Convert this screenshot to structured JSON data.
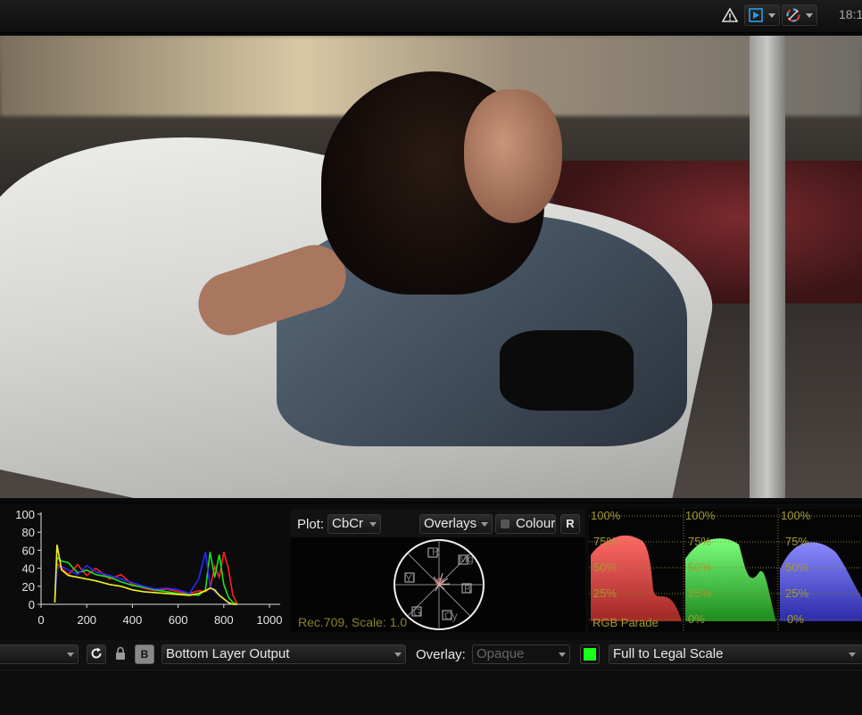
{
  "topbar": {
    "warning_icon": "warning-triangle-icon",
    "view_icon": "play-monitor-icon",
    "colour_icon": "colour-wheel-icon",
    "time": "18:1"
  },
  "histogram": {
    "y_ticks": [
      "100",
      "80",
      "60",
      "40",
      "20",
      "0"
    ],
    "x_ticks": [
      "0",
      "200",
      "400",
      "600",
      "800",
      "1000"
    ]
  },
  "vectorscope": {
    "plot_label": "Plot:",
    "plot_value": "CbCr",
    "overlays_label": "Overlays",
    "colour_label": "Colour",
    "r_button": "R",
    "targets": [
      "R",
      "Mg",
      "B",
      "Cy",
      "G",
      "Yl"
    ],
    "note": "Rec.709, Scale: 1.0"
  },
  "parade": {
    "title": "RGB Parade",
    "levels": [
      "100%",
      "75%",
      "50%",
      "25%",
      "0%"
    ],
    "colors": {
      "red": "#e2433f",
      "green": "#3fc83f",
      "blue": "#4a4ae6"
    }
  },
  "toolbar": {
    "refresh_icon": "refresh-icon",
    "lock_icon": "padlock-icon",
    "b_button": "B",
    "output_select": "Bottom Layer Output",
    "overlay_label": "Overlay:",
    "overlay_value": "Opaque",
    "scale_select": "Full to Legal Scale",
    "swatch_color": "#18ff18"
  },
  "chart_data": {
    "type": "line",
    "x": [
      60,
      70,
      90,
      120,
      160,
      200,
      240,
      300,
      350,
      400,
      450,
      500,
      550,
      600,
      650,
      690,
      720,
      740,
      760,
      780,
      800,
      820,
      840,
      860
    ],
    "series": [
      {
        "color": "#ff2020",
        "values": [
          2,
          45,
          40,
          33,
          44,
          32,
          40,
          28,
          33,
          22,
          18,
          15,
          17,
          14,
          12,
          15,
          14,
          18,
          42,
          30,
          58,
          40,
          10,
          0
        ]
      },
      {
        "color": "#20e020",
        "values": [
          2,
          52,
          48,
          46,
          35,
          38,
          33,
          30,
          25,
          21,
          19,
          16,
          14,
          12,
          11,
          10,
          16,
          58,
          30,
          55,
          22,
          8,
          2,
          0
        ]
      },
      {
        "color": "#2a2aff",
        "values": [
          2,
          40,
          42,
          38,
          33,
          43,
          36,
          32,
          28,
          24,
          20,
          17,
          18,
          16,
          12,
          28,
          58,
          20,
          14,
          10,
          6,
          2,
          0,
          0
        ]
      },
      {
        "color": "#f0f020",
        "values": [
          2,
          66,
          38,
          32,
          30,
          28,
          26,
          22,
          20,
          16,
          14,
          13,
          12,
          11,
          10,
          12,
          15,
          18,
          16,
          10,
          6,
          2,
          0,
          0
        ]
      }
    ],
    "xlim": [
      0,
      1000
    ],
    "ylim": [
      0,
      100
    ],
    "x_ticks": [
      0,
      200,
      400,
      600,
      800,
      1000
    ],
    "y_ticks": [
      0,
      20,
      40,
      60,
      80,
      100
    ]
  }
}
